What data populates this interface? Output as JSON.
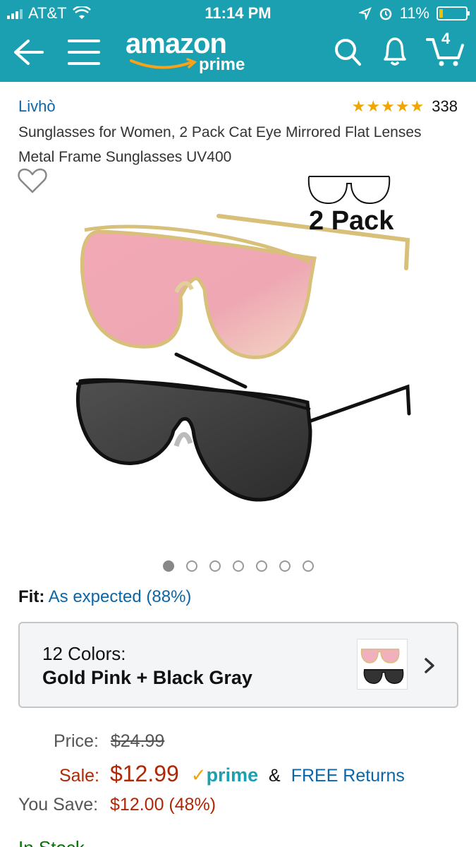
{
  "status_bar": {
    "carrier": "AT&T",
    "time": "11:14 PM",
    "battery_percent": "11%"
  },
  "nav": {
    "logo_text": "amazon",
    "logo_subtext": "prime",
    "cart_count": "4"
  },
  "product": {
    "brand": "Livhò",
    "rating_count": "338",
    "rating_stars": "★★★★★",
    "title": "Sunglasses for Women, 2 Pack Cat Eye Mirrored Flat Lenses Metal Frame Sunglasses UV400",
    "image_label": "2 Pack",
    "image_count": 7,
    "active_image": 1
  },
  "fit": {
    "label": "Fit:",
    "value": "As expected (88%)"
  },
  "colors": {
    "count_label": "12 Colors:",
    "selected": "Gold Pink + Black Gray"
  },
  "pricing": {
    "price_label": "Price:",
    "list_price": "$24.99",
    "sale_label": "Sale:",
    "sale_price": "$12.99",
    "check_mark": "✓",
    "prime_label": "prime",
    "amp": "&",
    "free_returns": "FREE Returns",
    "save_label": "You Save:",
    "save_value": "$12.00 (48%)"
  },
  "stock": "In Stock.",
  "colors_map": {
    "nav_bg": "#1aa0b0",
    "link": "#0b66a8",
    "price": "#b12704",
    "star": "#f0a500"
  }
}
